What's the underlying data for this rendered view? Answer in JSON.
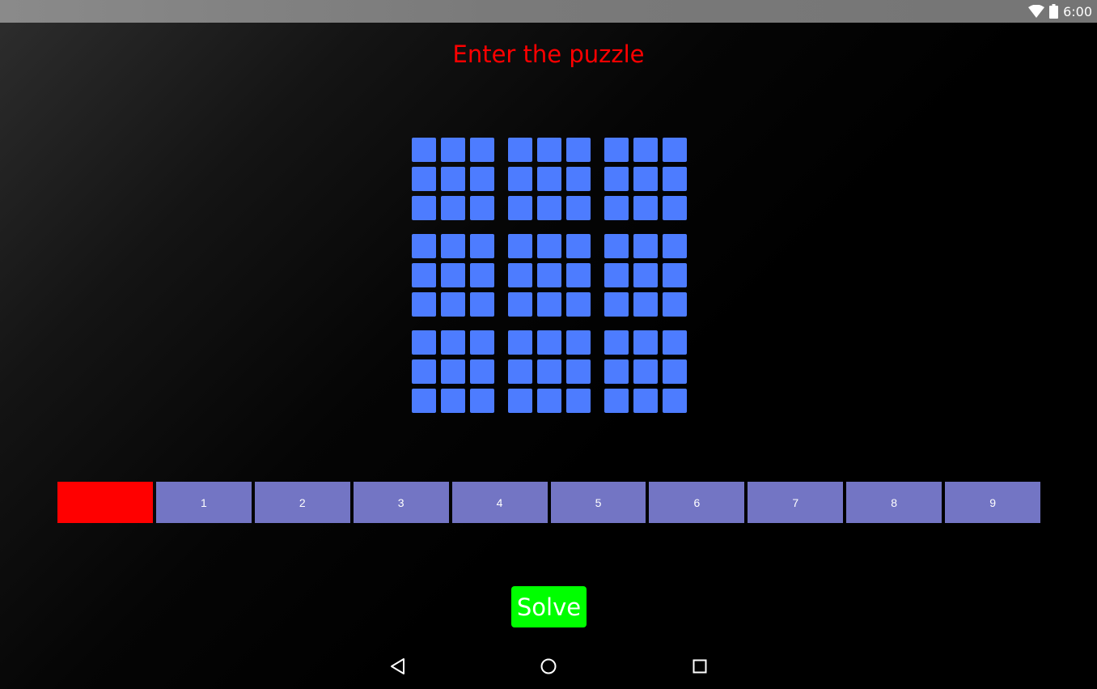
{
  "status_bar": {
    "time": "6:00",
    "icons": [
      "wifi-icon",
      "battery-icon"
    ]
  },
  "title": "Enter the puzzle",
  "title_color": "#ff0000",
  "grid": {
    "rows": 9,
    "cols": 9,
    "cell_color": "#4d7cff",
    "values": [
      [
        "",
        "",
        "",
        "",
        "",
        "",
        "",
        "",
        ""
      ],
      [
        "",
        "",
        "",
        "",
        "",
        "",
        "",
        "",
        ""
      ],
      [
        "",
        "",
        "",
        "",
        "",
        "",
        "",
        "",
        ""
      ],
      [
        "",
        "",
        "",
        "",
        "",
        "",
        "",
        "",
        ""
      ],
      [
        "",
        "",
        "",
        "",
        "",
        "",
        "",
        "",
        ""
      ],
      [
        "",
        "",
        "",
        "",
        "",
        "",
        "",
        "",
        ""
      ],
      [
        "",
        "",
        "",
        "",
        "",
        "",
        "",
        "",
        ""
      ],
      [
        "",
        "",
        "",
        "",
        "",
        "",
        "",
        "",
        ""
      ],
      [
        "",
        "",
        "",
        "",
        "",
        "",
        "",
        "",
        ""
      ]
    ]
  },
  "digit_buttons": [
    {
      "label": "",
      "color": "#ff0000"
    },
    {
      "label": "1",
      "color": "#7375c4"
    },
    {
      "label": "2",
      "color": "#7375c4"
    },
    {
      "label": "3",
      "color": "#7375c4"
    },
    {
      "label": "4",
      "color": "#7375c4"
    },
    {
      "label": "5",
      "color": "#7375c4"
    },
    {
      "label": "6",
      "color": "#7375c4"
    },
    {
      "label": "7",
      "color": "#7375c4"
    },
    {
      "label": "8",
      "color": "#7375c4"
    },
    {
      "label": "9",
      "color": "#7375c4"
    }
  ],
  "solve_button": {
    "label": "Solve",
    "color": "#00ff00"
  },
  "nav_bar": {
    "icons": [
      "back-icon",
      "home-icon",
      "recents-icon"
    ]
  }
}
